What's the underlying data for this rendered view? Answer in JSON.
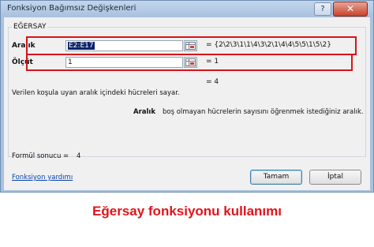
{
  "window": {
    "title": "Fonksiyon Bağımsız Değişkenleri",
    "help_label": "?",
    "close_label": "✕"
  },
  "function_name": "EĞERSAY",
  "arguments": [
    {
      "label": "Aralık",
      "value": "E2:E17",
      "result": "= {2\\2\\3\\1\\1\\4\\3\\2\\1\\4\\4\\5\\5\\1\\5\\2}"
    },
    {
      "label": "Ölçüt",
      "value": "1",
      "result": "= 1"
    }
  ],
  "overall_result": "= 4",
  "function_description": "Verilen koşula uyan aralık içindeki hücreleri sayar.",
  "argument_help": {
    "name": "Aralık",
    "text": "boş olmayan hücrelerin sayısını öğrenmek istediğiniz aralık."
  },
  "formula_result": {
    "label": "Formül sonucu =",
    "value": "4"
  },
  "help_link": "Fonksiyon yardımı",
  "buttons": {
    "ok": "Tamam",
    "cancel": "İptal"
  },
  "caption": "Eğersay fonksiyonu kullanımı",
  "colors": {
    "highlight_border": "#d6141a",
    "caption": "#e3131a",
    "link": "#0645ad"
  },
  "icons": [
    "help-icon",
    "close-icon",
    "collapse-dialog-icon"
  ]
}
